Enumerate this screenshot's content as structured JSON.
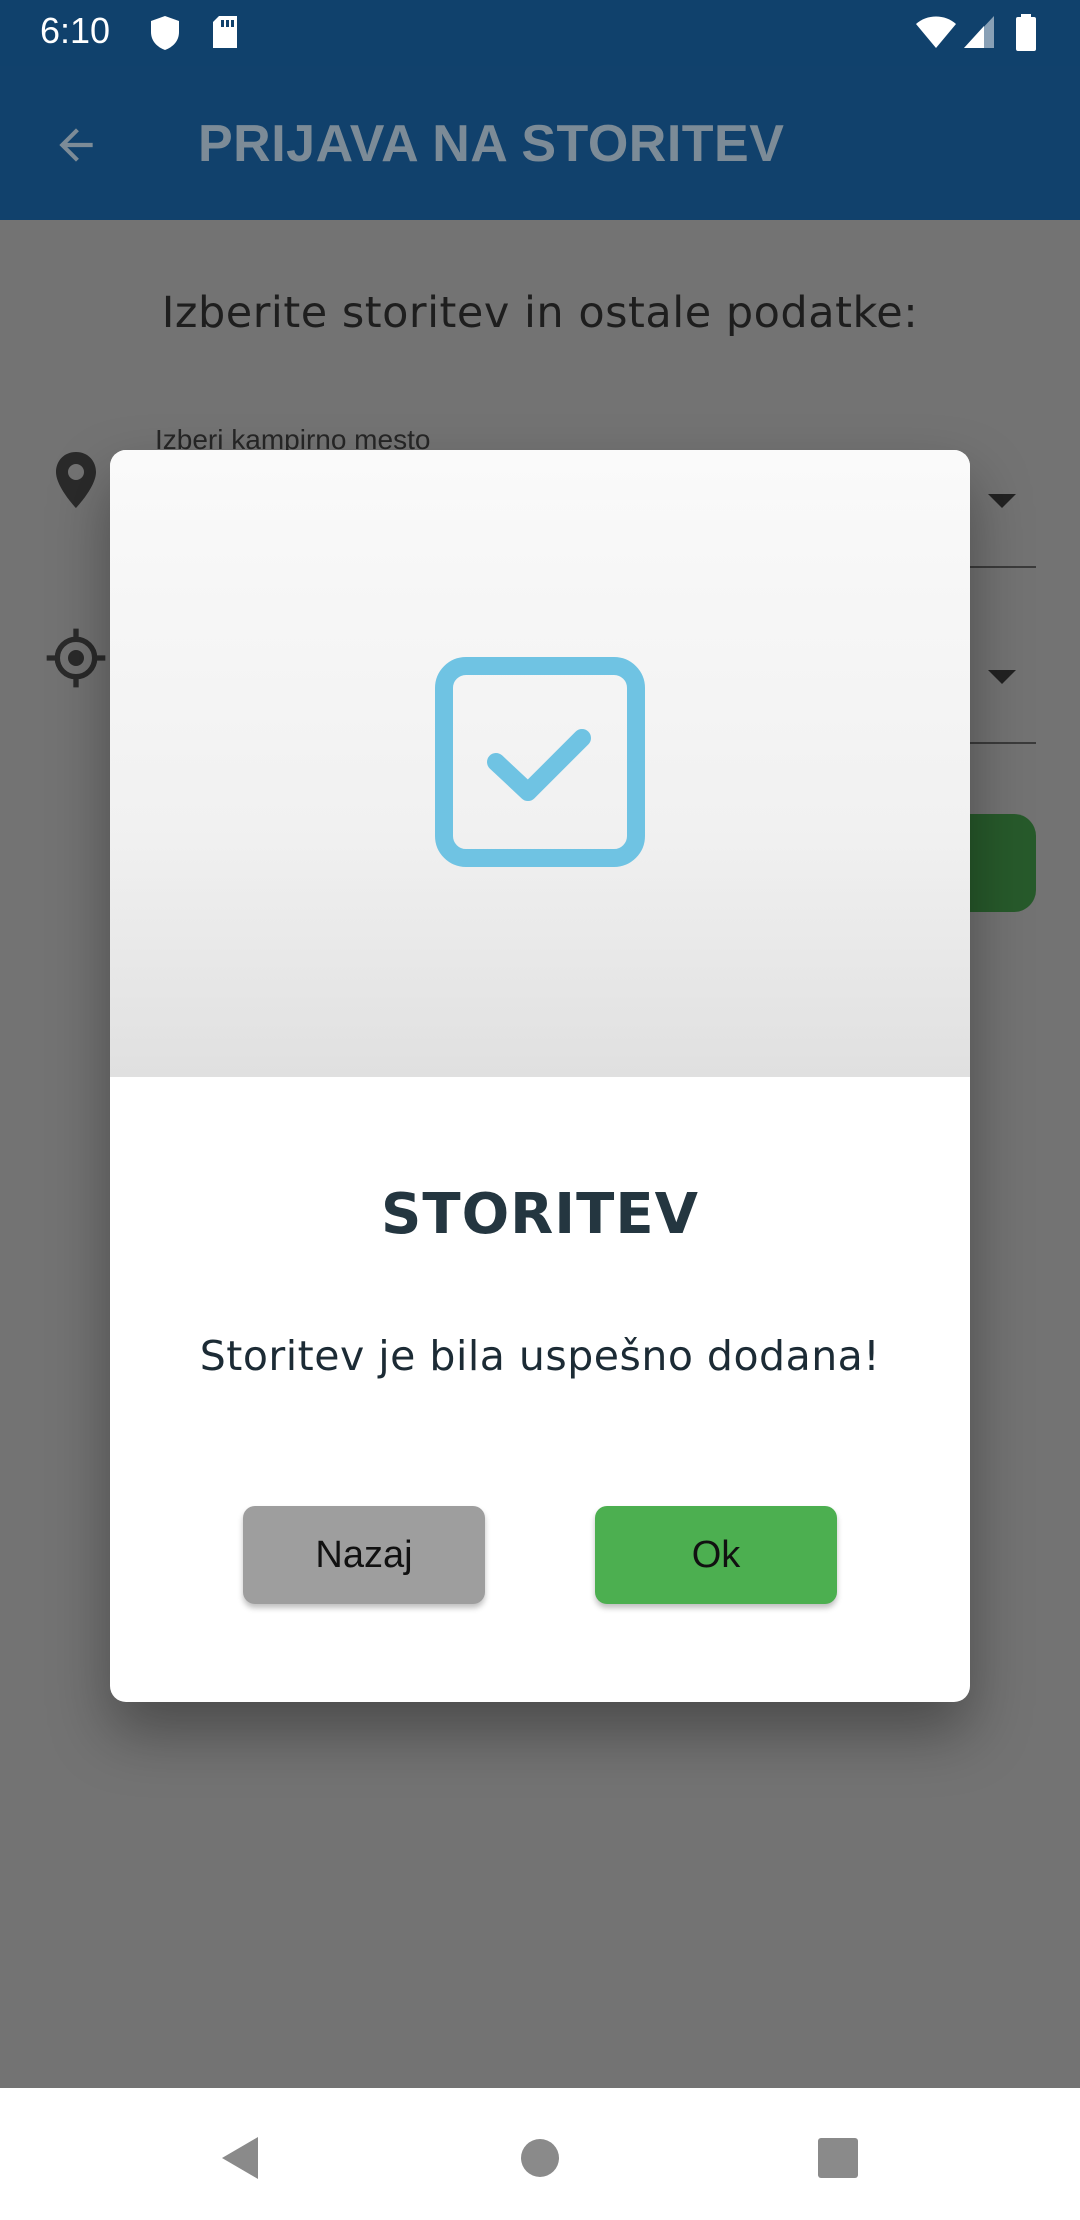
{
  "status_bar": {
    "time": "6:10",
    "icons": [
      "shield-icon",
      "sd-card-icon",
      "wifi-icon",
      "signal-icon",
      "battery-icon"
    ]
  },
  "app_bar": {
    "title": "PRIJAVA NA STORITEV",
    "back_icon": "arrow-back-icon"
  },
  "form": {
    "prompt": "Izberite storitev in ostale podatke:",
    "field1_label": "Izberi kampirno mesto"
  },
  "dialog": {
    "icon": "checkbox-checked-icon",
    "title": "STORITEV",
    "message": "Storitev je bila uspešno dodana!",
    "cancel_label": "Nazaj",
    "ok_label": "Ok"
  },
  "colors": {
    "app_bar": "#11416c",
    "ok_button": "#4caf50",
    "cancel_button": "#9e9e9e",
    "check_icon": "#6fc3e3"
  },
  "nav_bar": {
    "icons": [
      "back-triangle-icon",
      "home-circle-icon",
      "recents-square-icon"
    ]
  }
}
